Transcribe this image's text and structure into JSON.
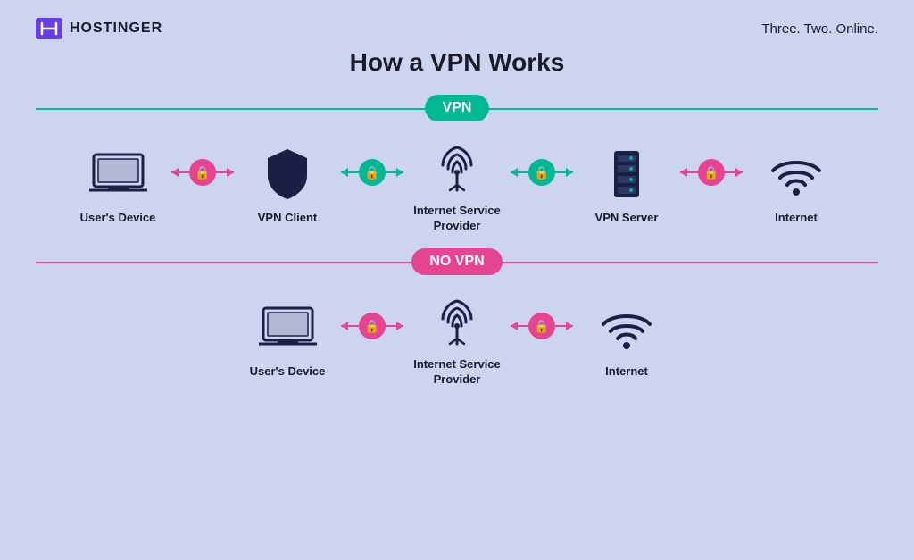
{
  "header": {
    "logo_text": "HOSTINGER",
    "tagline": "Three. Two. Online."
  },
  "main": {
    "title": "How a VPN Works"
  },
  "vpn_section": {
    "badge": "VPN",
    "items": [
      {
        "label": "User's Device",
        "icon": "laptop"
      },
      {
        "label": "VPN Client",
        "icon": "shield"
      },
      {
        "label": "Internet Service Provider",
        "icon": "tower"
      },
      {
        "label": "VPN Server",
        "icon": "server"
      },
      {
        "label": "Internet",
        "icon": "wifi"
      }
    ],
    "connectors": [
      {
        "type": "red"
      },
      {
        "type": "green"
      },
      {
        "type": "green"
      },
      {
        "type": "red"
      }
    ]
  },
  "novpn_section": {
    "badge": "NO VPN",
    "items": [
      {
        "label": "User's Device",
        "icon": "laptop"
      },
      {
        "label": "Internet Service Provider",
        "icon": "tower"
      },
      {
        "label": "Internet",
        "icon": "wifi"
      }
    ],
    "connectors": [
      {
        "type": "red"
      },
      {
        "type": "red"
      }
    ]
  },
  "colors": {
    "accent_green": "#00b894",
    "accent_pink": "#e84393",
    "dark_navy": "#1a2044",
    "bg": "#cdd4f0"
  }
}
